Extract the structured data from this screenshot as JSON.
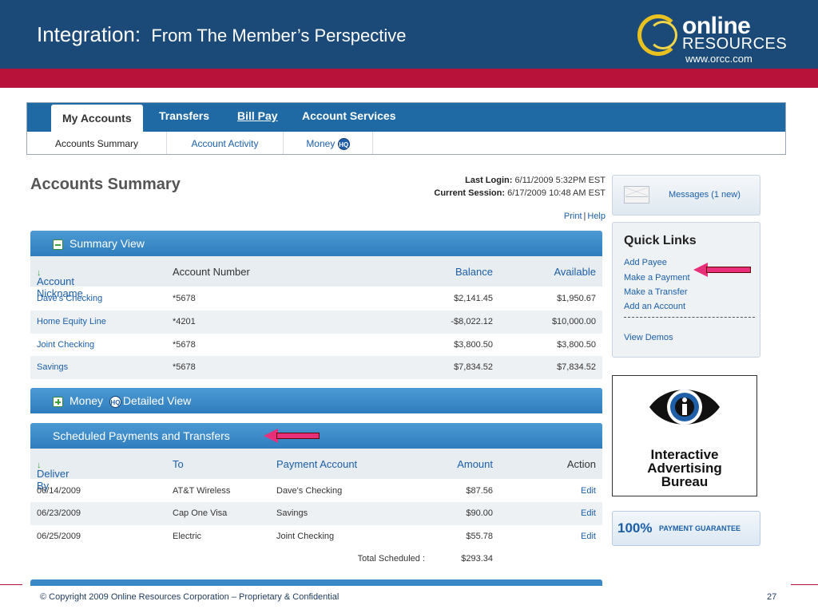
{
  "slide": {
    "title": "Integration:",
    "subtitle": "From The Member’s Perspective",
    "logo_line1": "online",
    "logo_line2": "RESOURCES",
    "logo_url": "www.orcc.com",
    "footer": "© Copyright 2009 Online Resources Corporation – Proprietary & Confidential",
    "page_number": "27"
  },
  "nav": {
    "tabs": [
      {
        "label": "My Accounts",
        "active": true
      },
      {
        "label": "Transfers",
        "active": false
      },
      {
        "label": "Bill Pay",
        "active": false
      },
      {
        "label": "Account Services",
        "active": false
      }
    ],
    "subnav": [
      {
        "label": "Accounts Summary",
        "active": true
      },
      {
        "label": "Account Activity",
        "active": false
      },
      {
        "label": "Money",
        "badge": "HQ",
        "active": false
      }
    ]
  },
  "summary": {
    "title": "Accounts Summary",
    "last_login_label": "Last Login:",
    "last_login_value": "6/11/2009 5:32PM EST",
    "current_session_label": "Current Session:",
    "current_session_value": "6/17/2009 10:48 AM EST",
    "print": "Print",
    "help": "Help",
    "sep": "|"
  },
  "summary_view": {
    "header": "Summary View",
    "columns": [
      "Account Nickname",
      "Account Number",
      "Balance",
      "Available"
    ],
    "rows": [
      {
        "nickname": "Dave's Checking",
        "number": "*5678",
        "balance": "$2,141.45",
        "available": "$1,950.67"
      },
      {
        "nickname": "Home Equity Line",
        "number": "*4201",
        "balance": "-$8,022.12",
        "available": "$10,000.00"
      },
      {
        "nickname": "Joint Checking",
        "number": "*5678",
        "balance": "$3,800.50",
        "available": "$3,800.50"
      },
      {
        "nickname": "Savings",
        "number": "*5678",
        "balance": "$7,834.52",
        "available": "$7,834.52"
      }
    ]
  },
  "money_view": {
    "label_before": "Money",
    "badge": "HQ",
    "label_after": "Detailed View"
  },
  "scheduled": {
    "header": "Scheduled Payments and Transfers",
    "columns": [
      "Deliver By",
      "To",
      "Payment Account",
      "Amount",
      "Action"
    ],
    "rows": [
      {
        "date": "06/14/2009",
        "to": "AT&T Wireless",
        "account": "Dave's Checking",
        "amount": "$87.56",
        "action": "Edit"
      },
      {
        "date": "06/23/2009",
        "to": "Cap One Visa",
        "account": "Savings",
        "amount": "$90.00",
        "action": "Edit"
      },
      {
        "date": "06/25/2009",
        "to": "Electric",
        "account": "Joint Checking",
        "amount": "$55.78",
        "action": "Edit"
      }
    ],
    "total_label": "Total Scheduled :",
    "total_value": "$293.34"
  },
  "sidebar": {
    "messages": "Messages (1 new)",
    "quick_links_title": "Quick Links",
    "quick_links": [
      "Add Payee",
      "Make a Payment",
      "Make a Transfer",
      "Add an Account"
    ],
    "view_demos": "View Demos",
    "iab_lines": [
      "Interactive",
      "Advertising",
      "Bureau"
    ],
    "guarantee_big": "100%",
    "guarantee_small": "PAYMENT GUARANTEE"
  },
  "colors": {
    "header_blue": "#1c4a78",
    "accent_red": "#b8123a",
    "nav_blue": "#1f6aa5",
    "link_blue": "#1b5fa8",
    "arrow_pink": "#e8307a"
  }
}
